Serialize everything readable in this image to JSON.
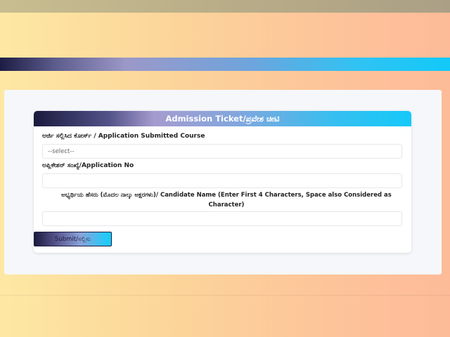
{
  "card": {
    "title": "Admission Ticket/ಪ್ರವೇಶ ಚೀಟಿ"
  },
  "form": {
    "course_label": "ಅರ್ಜಿ ಸಲ್ಲಿಸಿದ ಕೋರ್ಸ್ / Application Submitted Course",
    "course_selected": "--select--",
    "appno_label": "ಅಪ್ಲಿಕೇಶನ್ ಸಂಖ್ಯೆ/Application No",
    "appno_value": "",
    "name_label": "ಅಭ್ಯರ್ಥಿಯ ಹೆಸರು (ಮೊದಲ ನಾಲ್ಕು ಅಕ್ಷರಗಳು)/ Candidate Name (Enter First 4 Characters, Space also Considered as Character)",
    "name_value": "",
    "submit_label": "Submit/ಸಲ್ಲಿಸು"
  },
  "colors": {
    "accent_dark": "#1a1a3e",
    "accent_cyan": "#14c9f9"
  }
}
